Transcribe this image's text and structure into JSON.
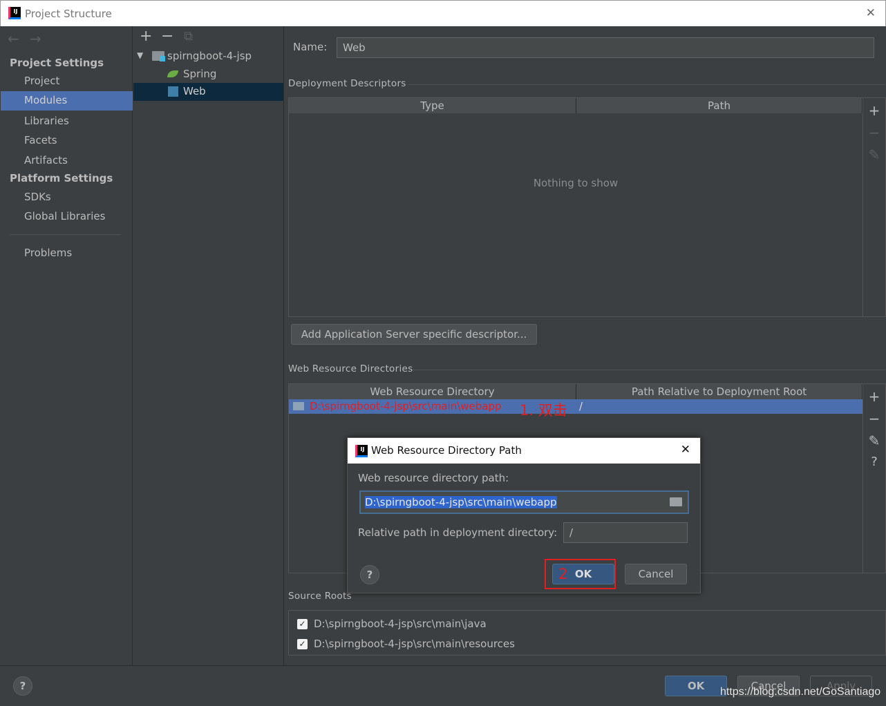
{
  "window": {
    "title": "Project Structure",
    "close": "✕"
  },
  "sidebar": {
    "back": "←",
    "forward": "→",
    "project_settings": "Project Settings",
    "items": [
      "Project",
      "Modules",
      "Libraries",
      "Facets",
      "Artifacts"
    ],
    "platform_settings": "Platform Settings",
    "platform_items": [
      "SDKs",
      "Global Libraries"
    ],
    "problems": "Problems",
    "selected": "Modules",
    "selected_color": "#4b6eaf"
  },
  "tree": {
    "add": "+",
    "remove": "−",
    "copy": "⧉",
    "root": "spirngboot-4-jsp",
    "children": [
      "Spring",
      "Web"
    ],
    "selected": "Web"
  },
  "main": {
    "name_label": "Name:",
    "name_value": "Web",
    "deployment": {
      "title": "Deployment Descriptors",
      "columns": [
        "Type",
        "Path"
      ],
      "empty": "Nothing to show",
      "add_button": "Add Application Server specific descriptor..."
    },
    "web_resources": {
      "title": "Web Resource Directories",
      "columns": [
        "Web Resource Directory",
        "Path Relative to Deployment Root"
      ],
      "rows": [
        {
          "directory": "D:\\spirngboot-4-jsp\\src\\main\\webapp",
          "relative": "/"
        }
      ]
    },
    "source_roots": {
      "title": "Source Roots",
      "items": [
        {
          "path": "D:\\spirngboot-4-jsp\\src\\main\\java",
          "checked": true
        },
        {
          "path": "D:\\spirngboot-4-jsp\\src\\main\\resources",
          "checked": true
        }
      ]
    },
    "tools": {
      "add": "+",
      "remove": "−",
      "edit": "✎",
      "help": "?"
    }
  },
  "annotations": {
    "step1": "1. 双击",
    "step2": "2",
    "color": "#e02020"
  },
  "dialog": {
    "title": "Web Resource Directory Path",
    "close": "✕",
    "path_label": "Web resource directory path:",
    "path_value": "D:\\spirngboot-4-jsp\\src\\main\\webapp",
    "relative_label": "Relative path in deployment directory:",
    "relative_value": "/",
    "help": "?",
    "ok": "OK",
    "cancel": "Cancel"
  },
  "footer": {
    "help": "?",
    "ok": "OK",
    "cancel": "Cancel",
    "apply": "Apply",
    "watermark": "https://blog.csdn.net/GoSantiago"
  }
}
